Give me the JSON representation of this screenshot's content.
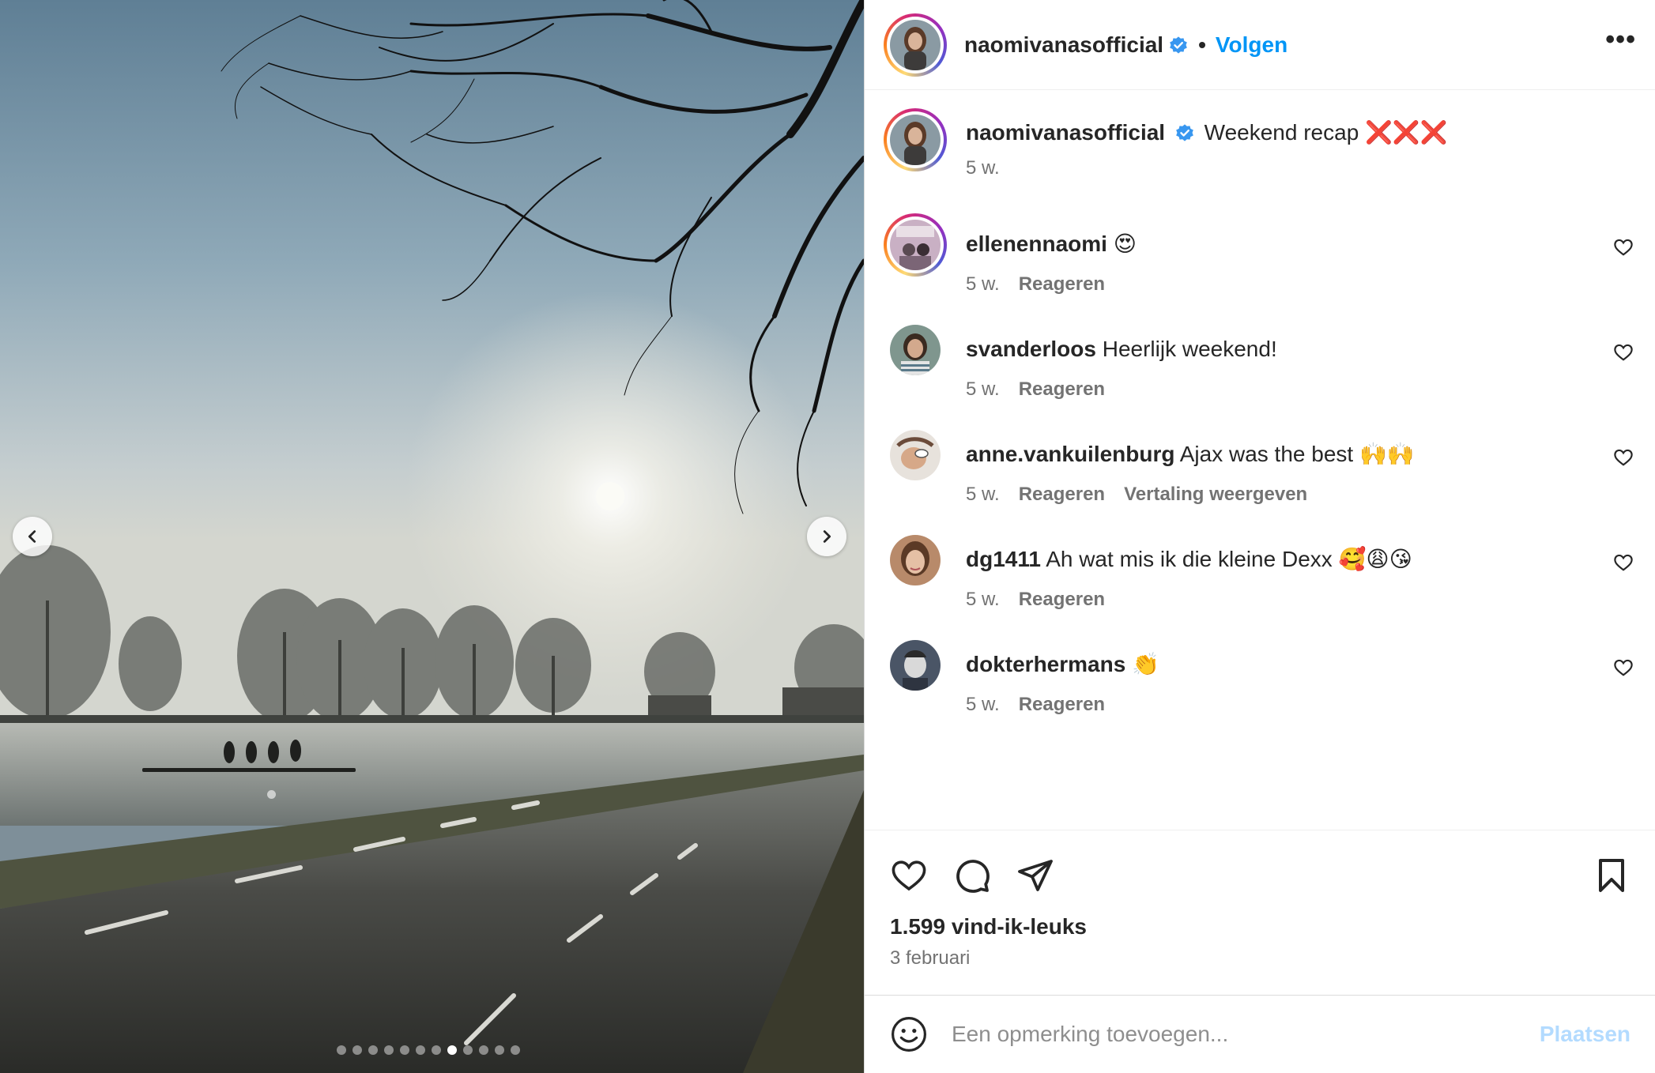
{
  "post": {
    "author": "naomivanasofficial",
    "follow_label": "Volgen",
    "separator": "•",
    "more_label": "•••",
    "caption_text": "Weekend recap",
    "caption_emoji": "❌❌❌",
    "caption_age": "5 w."
  },
  "carousel": {
    "slide_count": 12,
    "active_index": 7
  },
  "comments": [
    {
      "user": "ellenennaomi",
      "text": "😍",
      "age": "5 w.",
      "reply": "Reageren",
      "translate": ""
    },
    {
      "user": "svanderloos",
      "text": "Heerlijk weekend!",
      "age": "5 w.",
      "reply": "Reageren",
      "translate": ""
    },
    {
      "user": "anne.vankuilenburg",
      "text": "Ajax was the best 🙌🙌",
      "age": "5 w.",
      "reply": "Reageren",
      "translate": "Vertaling weergeven"
    },
    {
      "user": "dg1411",
      "text": "Ah wat mis ik die kleine Dexx 🥰😩😘",
      "age": "5 w.",
      "reply": "Reageren",
      "translate": ""
    },
    {
      "user": "dokterhermans",
      "text": "👏",
      "age": "5 w.",
      "reply": "Reageren",
      "translate": ""
    }
  ],
  "stats": {
    "likes": "1.599 vind-ik-leuks",
    "date": "3 februari"
  },
  "composer": {
    "placeholder": "Een opmerking toevoegen...",
    "submit_label": "Plaatsen"
  },
  "colors": {
    "link": "#0095f6",
    "muted": "#737373",
    "post_disabled": "#b3dbff",
    "verified": "#3897f0"
  },
  "icons": [
    "chevron-left-icon",
    "chevron-right-icon",
    "verified-badge-icon",
    "more-icon",
    "heart-icon",
    "comment-icon",
    "share-icon",
    "bookmark-icon",
    "emoji-icon"
  ]
}
